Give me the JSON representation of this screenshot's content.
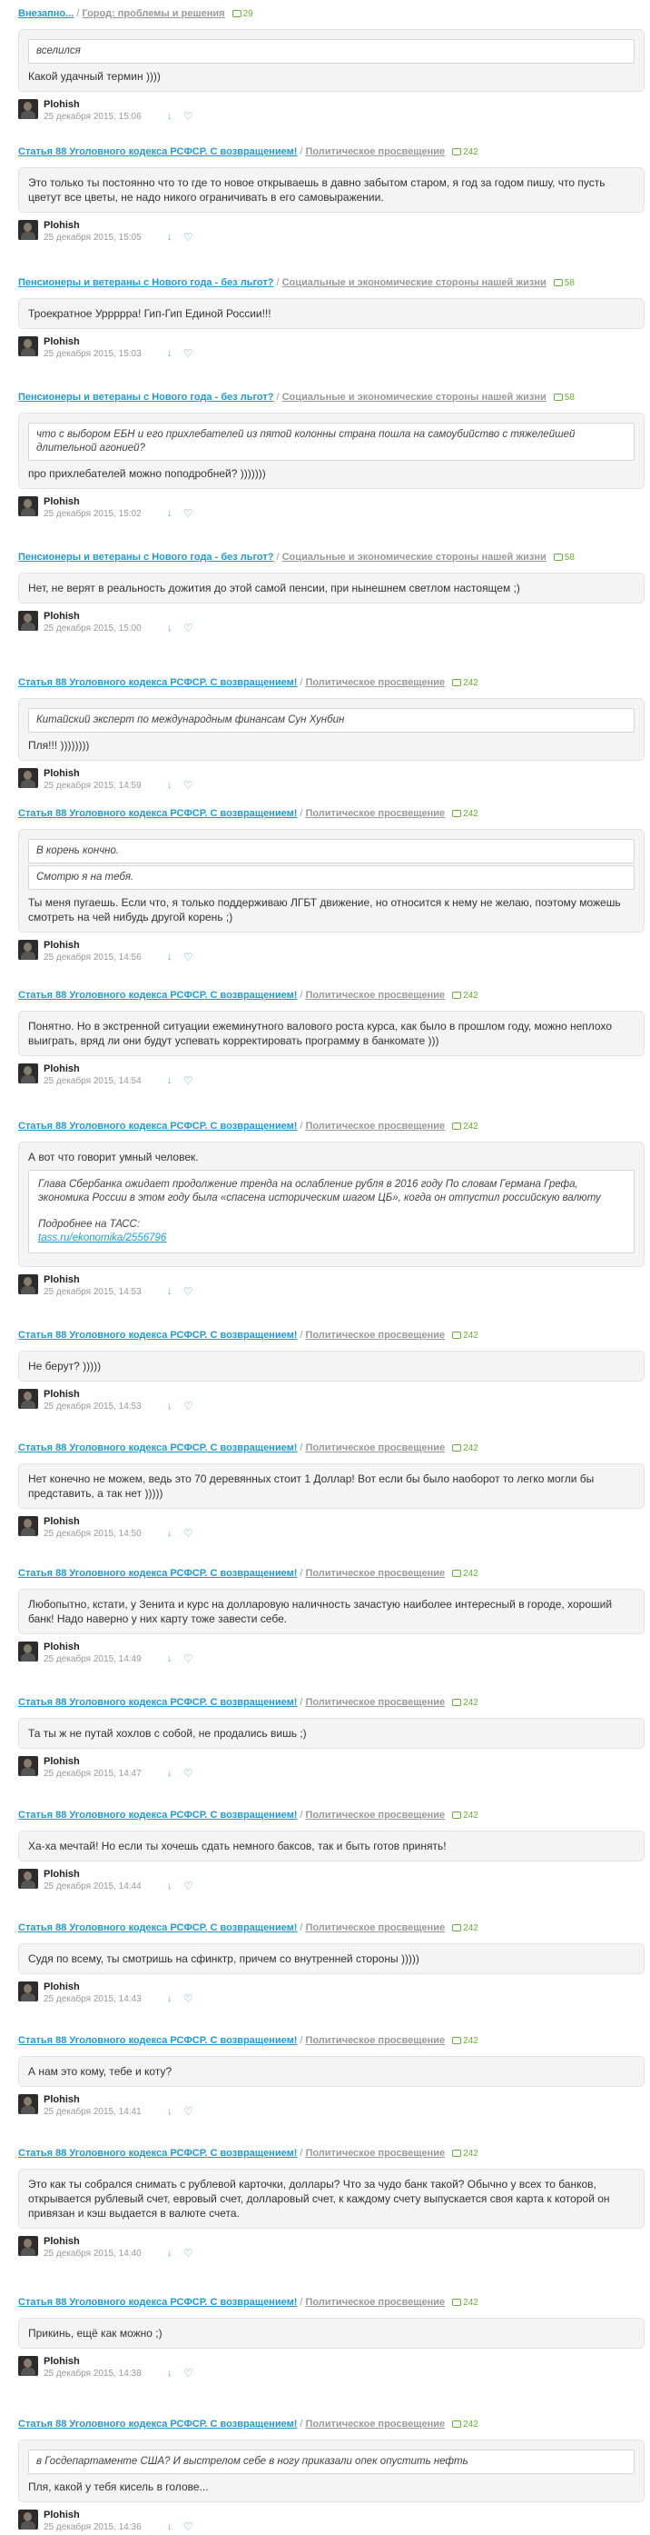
{
  "user": "Plohish",
  "icons": {
    "comments": "comment-bubble-icon",
    "rate_down": "arrow-down-icon",
    "like": "heart-icon",
    "avatar": "user-avatar"
  },
  "colors": {
    "topic_link": "#1e9bd7",
    "category_link": "#9a9a9a",
    "count": "#66b233",
    "action_icons": "#5aa8d8"
  },
  "entries": [
    {
      "topic": "Внезапно...",
      "category": "Город: проблемы и решения",
      "count": "29",
      "quotes": [
        "вселился"
      ],
      "text": "Какой удачный термин ))))",
      "date": "25 декабря 2015, 15:06"
    },
    {
      "topic": "Статья 88 Уголовного кодекса РСФСР. С возвращением!",
      "category": "Политическое просвещение",
      "count": "242",
      "quotes": [],
      "text": "Это только ты постоянно что то где то новое открываешь в давно забытом старом, я год за годом пишу, что пусть цветут все цветы, не надо никого ограничивать в его самовыражении.",
      "date": "25 декабря 2015, 15:05"
    },
    {
      "topic": "Пенсионеры и ветераны с Нового года - без льгот?",
      "category": "Социальные и экономические стороны нашей жизни",
      "count": "58",
      "quotes": [],
      "text": "Троекратное Урррррa! Гип-Гип Единой России!!!",
      "date": "25 декабря 2015, 15:03"
    },
    {
      "topic": "Пенсионеры и ветераны с Нового года - без льгот?",
      "category": "Социальные и экономические стороны нашей жизни",
      "count": "58",
      "quotes": [
        "что с выбором ЕБН и его прихлебателей из пятой колонны страна пошла на самоубийство с тяжелейшей длительной агонией?"
      ],
      "text": "про прихлебателей можно поподробней? )))))))",
      "date": "25 декабря 2015, 15:02"
    },
    {
      "topic": "Пенсионеры и ветераны с Нового года - без льгот?",
      "category": "Социальные и экономические стороны нашей жизни",
      "count": "58",
      "quotes": [],
      "text": "Нет, не верят в реальность дожития до этой самой пенсии, при нынешнем светлом настоящем ;)",
      "date": "25 декабря 2015, 15:00"
    },
    {
      "topic": "Статья 88 Уголовного кодекса РСФСР. С возвращением!",
      "category": "Политическое просвещение",
      "count": "242",
      "quotes": [
        "Китайский эксперт по международным финансам Сун Хунбин"
      ],
      "text": "Пля!!! ))))))))",
      "date": "25 декабря 2015, 14:59"
    },
    {
      "topic": "Статья 88 Уголовного кодекса РСФСР. С возвращением!",
      "category": "Политическое просвещение",
      "count": "242",
      "quotes": [
        "В корень кончно.",
        "Смотрю я на тебя."
      ],
      "text": "Ты меня пугаешь. Если что, я только поддерживаю ЛГБТ движение, но относится к нему не желаю, поэтому можешь смотреть на чей нибудь другой корень ;)",
      "date": "25 декабря 2015, 14:56"
    },
    {
      "topic": "Статья 88 Уголовного кодекса РСФСР. С возвращением!",
      "category": "Политическое просвещение",
      "count": "242",
      "quotes": [],
      "text": "Понятно. Но в экстренной ситуации ежеминутного валового роста курса, как было в прошлом году, можно неплохо выиграть, вряд ли они будут успевать корректировать программу в банкомате )))",
      "date": "25 декабря 2015, 14:54"
    },
    {
      "topic": "Статья 88 Уголовного кодекса РСФСР. С возвращением!",
      "category": "Политическое просвещение",
      "count": "242",
      "intro": "А вот что говорит умный человек.",
      "quotes": [],
      "bigquote": {
        "text": "Глава Сбербанка ожидает продолжение тренда на ослабление рубля в 2016 году По словам Германа Грефа, экономика России в этом году была «спасена историческим шагом ЦБ», когда он отпустил российскую валюту",
        "more": "Подробнее на ТАСС:",
        "link": "tass.ru/ekonomika/2556796"
      },
      "text": "",
      "date": "25 декабря 2015, 14:53"
    },
    {
      "topic": "Статья 88 Уголовного кодекса РСФСР. С возвращением!",
      "category": "Политическое просвещение",
      "count": "242",
      "quotes": [],
      "text": "Не берут? )))))",
      "date": "25 декабря 2015, 14:53"
    },
    {
      "topic": "Статья 88 Уголовного кодекса РСФСР. С возвращением!",
      "category": "Политическое просвещение",
      "count": "242",
      "quotes": [],
      "text": "Нет конечно не можем, ведь это 70 деревянных стоит 1 Доллар! Вот если бы было наоборот то легко могли бы представить, а так нет )))))",
      "date": "25 декабря 2015, 14:50"
    },
    {
      "topic": "Статья 88 Уголовного кодекса РСФСР. С возвращением!",
      "category": "Политическое просвещение",
      "count": "242",
      "quotes": [],
      "text": "Любопытно, кстати, у Зенита и курс на долларовую наличность зачастую наиболее интересный в городе, хороший банк! Надо наверно у них карту тоже завести себе.",
      "date": "25 декабря 2015, 14:49"
    },
    {
      "topic": "Статья 88 Уголовного кодекса РСФСР. С возвращением!",
      "category": "Политическое просвещение",
      "count": "242",
      "quotes": [],
      "text": "Та ты ж не путай хохлов с собой, не продались вишь ;)",
      "date": "25 декабря 2015, 14:47"
    },
    {
      "topic": "Статья 88 Уголовного кодекса РСФСР. С возвращением!",
      "category": "Политическое просвещение",
      "count": "242",
      "quotes": [],
      "text": "Ха-ха мечтай! Но если ты хочешь сдать немного баксов, так и быть готов принять!",
      "date": "25 декабря 2015, 14:44"
    },
    {
      "topic": "Статья 88 Уголовного кодекса РСФСР. С возвращением!",
      "category": "Политическое просвещение",
      "count": "242",
      "quotes": [],
      "text": "Судя по всему, ты смотришь на сфинктр, причем со внутренней стороны )))))",
      "date": "25 декабря 2015, 14:43"
    },
    {
      "topic": "Статья 88 Уголовного кодекса РСФСР. С возвращением!",
      "category": "Политическое просвещение",
      "count": "242",
      "quotes": [],
      "text": "А нам это кому, тебе и коту?",
      "date": "25 декабря 2015, 14:41"
    },
    {
      "topic": "Статья 88 Уголовного кодекса РСФСР. С возвращением!",
      "category": "Политическое просвещение",
      "count": "242",
      "quotes": [],
      "text": "Это как ты собрался снимать с рублевой карточки, доллары? Что за чудо банк такой? Обычно у всех то банков, открывается рублевый счет, евровый счет, долларовый счет, к каждому счету выпускается своя карта к которой он привязан и кэш выдается в валюте счета.",
      "date": "25 декабря 2015, 14:40"
    },
    {
      "topic": "Статья 88 Уголовного кодекса РСФСР. С возвращением!",
      "category": "Политическое просвещение",
      "count": "242",
      "quotes": [],
      "text": "Прикинь, ещё как можно ;)",
      "date": "25 декабря 2015, 14:38"
    },
    {
      "topic": "Статья 88 Уголовного кодекса РСФСР. С возвращением!",
      "category": "Политическое просвещение",
      "count": "242",
      "quotes": [
        "в Госдепартаменте США? И выстрелом себе в ногу приказали опек опустить нефть"
      ],
      "text": "Пля, какой у тебя кисель в голове...",
      "date": "25 декабря 2015, 14:36"
    }
  ]
}
